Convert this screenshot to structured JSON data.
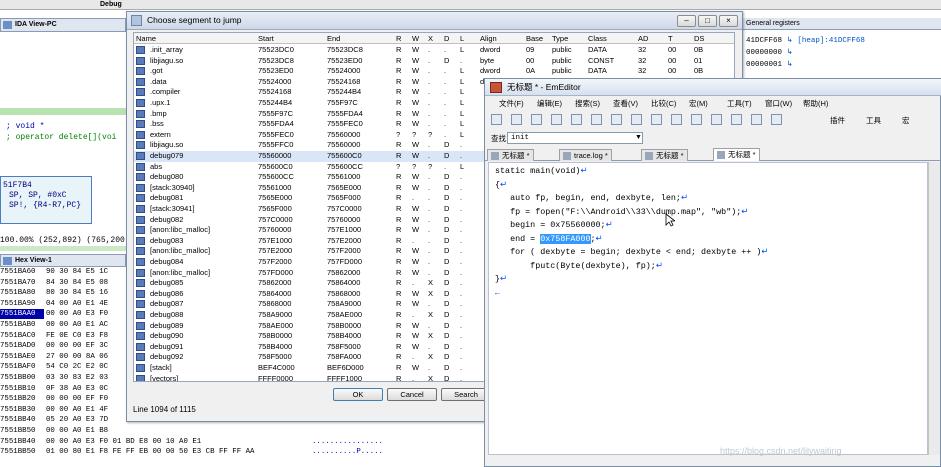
{
  "ida": {
    "debug_tab": "Debug",
    "view_title": "IDA View-PC",
    "code_lines": [
      "; void *",
      "; operator delete[](voi"
    ],
    "node_lines": [
      "51F7B4",
      "SP, SP, #0xC",
      "SP!, {R4-R7,PC}"
    ],
    "status": "100.00% (252,892) (765,200)",
    "hex_title": "Hex View-1",
    "hex_rows": [
      {
        "addr": "7551BA60",
        "bytes": "90 30 84 E5 1C",
        "ascii": ""
      },
      {
        "addr": "7551BA70",
        "bytes": "84 30 84 E5 08",
        "ascii": ""
      },
      {
        "addr": "7551BA80",
        "bytes": "80 30 84 E5 16",
        "ascii": ""
      },
      {
        "addr": "7551BA90",
        "bytes": "04 00 A0 E1 4E",
        "ascii": ""
      },
      {
        "addr": "7551BAA0",
        "bytes": "00 00 A0 E3 F0",
        "ascii": ""
      },
      {
        "addr": "7551BAB0",
        "bytes": "00 00 A0 E1 AC",
        "ascii": ""
      },
      {
        "addr": "7551BAC0",
        "bytes": "FE 0E C0 E3 F8",
        "ascii": ""
      },
      {
        "addr": "7551BAD0",
        "bytes": "00 00 00 EF 3C",
        "ascii": ""
      },
      {
        "addr": "7551BAE0",
        "bytes": "27 00 00 8A 06",
        "ascii": ""
      },
      {
        "addr": "7551BAF0",
        "bytes": "54 C0 2C E2 0C",
        "ascii": ""
      },
      {
        "addr": "7551BB00",
        "bytes": "03 30 83 E2 03",
        "ascii": ""
      },
      {
        "addr": "7551BB10",
        "bytes": "0F 38 A0 E3 0C",
        "ascii": ""
      },
      {
        "addr": "7551BB20",
        "bytes": "00 00 00 EF F0",
        "ascii": ""
      },
      {
        "addr": "7551BB30",
        "bytes": "00 00 A0 E1 4F",
        "ascii": ""
      },
      {
        "addr": "7551BB40",
        "bytes": "05 20 A0 E3 7D",
        "ascii": ""
      },
      {
        "addr": "7551BB50",
        "bytes": "00 00 A0 E1 B8",
        "ascii": ""
      },
      {
        "addr": "7551BB40",
        "bytes": "00 00 A0 E3 F0 01 BD E8 00 10 A0 E1",
        "ascii": "................"
      },
      {
        "addr": "7551BB50",
        "bytes": "01 00 80 E1 F8 FE FF EB 00 00 50 E3 CB FF FF AA",
        "ascii": "..........P....."
      }
    ],
    "highlight_row": 4
  },
  "registers": {
    "title": "General registers",
    "rows": [
      {
        "val": "41DCFF68",
        "cmt": "↳ [heap]:41DCFF68"
      },
      {
        "val": "00000000",
        "cmt": "↳"
      },
      {
        "val": "00000001",
        "cmt": "↳"
      }
    ]
  },
  "dialog": {
    "title": "Choose segment to jump",
    "headers": [
      "Name",
      "Start",
      "End",
      "R",
      "W",
      "X",
      "D",
      "L",
      "Align",
      "Base",
      "Type",
      "Class",
      "AD",
      "T",
      "DS"
    ],
    "rows": [
      [
        ".init_array",
        "75523DC0",
        "75523DC8",
        "R",
        "W",
        ".",
        ".",
        "L",
        "dword",
        "09",
        "public",
        "DATA",
        "32",
        "00",
        "0B"
      ],
      [
        "libjiagu.so",
        "75523DC8",
        "75523ED0",
        "R",
        "W",
        ".",
        "D",
        ".",
        "byte",
        "00",
        "public",
        "CONST",
        "32",
        "00",
        "01"
      ],
      [
        ".got",
        "75523ED0",
        "75524000",
        "R",
        "W",
        ".",
        ".",
        "L",
        "dword",
        "0A",
        "public",
        "DATA",
        "32",
        "00",
        "0B"
      ],
      [
        ".data",
        "75524000",
        "75524168",
        "R",
        "W",
        ".",
        ".",
        "L",
        "dword",
        "0B",
        "public",
        "DATA",
        "32",
        "00",
        "0B"
      ],
      [
        ".compiler",
        "75524168",
        "755244B4",
        "R",
        "W",
        ".",
        ".",
        "L",
        "",
        "",
        "",
        "",
        "",
        "",
        ""
      ],
      [
        ".upx.1",
        "755244B4",
        "755F97C",
        "R",
        "W",
        ".",
        ".",
        "L",
        "",
        "",
        "",
        "",
        "",
        "",
        ""
      ],
      [
        ".bmp",
        "7555F97C",
        "7555FDA4",
        "R",
        "W",
        ".",
        ".",
        "L",
        "",
        "",
        "",
        "",
        "",
        "",
        ""
      ],
      [
        ".bss",
        "7555FDA4",
        "7555FEC0",
        "R",
        "W",
        ".",
        ".",
        "L",
        "",
        "",
        "",
        "",
        "",
        "",
        ""
      ],
      [
        "extern",
        "7555FEC0",
        "75560000",
        "?",
        "?",
        "?",
        ".",
        "L",
        "",
        "",
        "",
        "",
        "",
        "",
        ""
      ],
      [
        "libjiagu.so",
        "7555FFC0",
        "75560000",
        "R",
        "W",
        ".",
        "D",
        ".",
        "",
        "",
        "",
        "",
        "",
        "",
        ""
      ],
      [
        "debug079",
        "75560000",
        "755600C0",
        "R",
        "W",
        ".",
        "D",
        ".",
        "",
        "",
        "",
        "",
        "",
        "",
        ""
      ],
      [
        "abs",
        "755600C0",
        "755600CC",
        "?",
        "?",
        "?",
        ".",
        "L",
        "",
        "",
        "",
        "",
        "",
        "",
        ""
      ],
      [
        "debug080",
        "755600CC",
        "75561000",
        "R",
        "W",
        ".",
        "D",
        ".",
        "",
        "",
        "",
        "",
        "",
        "",
        ""
      ],
      [
        "[stack:30940]",
        "75561000",
        "7565E000",
        "R",
        "W",
        ".",
        "D",
        ".",
        "",
        "",
        "",
        "",
        "",
        "",
        ""
      ],
      [
        "debug081",
        "7565E000",
        "7565F000",
        "R",
        ".",
        ".",
        "D",
        ".",
        "",
        "",
        "",
        "",
        "",
        "",
        ""
      ],
      [
        "[stack:30941]",
        "7565F000",
        "757C0000",
        "R",
        "W",
        ".",
        "D",
        ".",
        "",
        "",
        "",
        "",
        "",
        "",
        ""
      ],
      [
        "debug082",
        "757C0000",
        "75760000",
        "R",
        "W",
        ".",
        "D",
        ".",
        "",
        "",
        "",
        "",
        "",
        "",
        ""
      ],
      [
        "[anon:libc_malloc]",
        "75760000",
        "757E1000",
        "R",
        "W",
        ".",
        "D",
        ".",
        "",
        "",
        "",
        "",
        "",
        "",
        ""
      ],
      [
        "debug083",
        "757E1000",
        "757E2000",
        "R",
        ".",
        ".",
        "D",
        ".",
        "",
        "",
        "",
        "",
        "",
        "",
        ""
      ],
      [
        "[anon:libc_malloc]",
        "757E2000",
        "757F2000",
        "R",
        "W",
        ".",
        "D",
        ".",
        "",
        "",
        "",
        "",
        "",
        "",
        ""
      ],
      [
        "debug084",
        "757F2000",
        "757FD000",
        "R",
        "W",
        ".",
        "D",
        ".",
        "",
        "",
        "",
        "",
        "",
        "",
        ""
      ],
      [
        "[anon:libc_malloc]",
        "757FD000",
        "75862000",
        "R",
        "W",
        ".",
        "D",
        ".",
        "",
        "",
        "",
        "",
        "",
        "",
        ""
      ],
      [
        "debug085",
        "75862000",
        "75864000",
        "R",
        ".",
        "X",
        "D",
        ".",
        "",
        "",
        "",
        "",
        "",
        "",
        ""
      ],
      [
        "debug086",
        "75864000",
        "75868000",
        "R",
        "W",
        "X",
        "D",
        ".",
        "",
        "",
        "",
        "",
        "",
        "",
        ""
      ],
      [
        "debug087",
        "75868000",
        "758A9000",
        "R",
        "W",
        ".",
        "D",
        ".",
        "",
        "",
        "",
        "",
        "",
        "",
        ""
      ],
      [
        "debug088",
        "758A9000",
        "758AE000",
        "R",
        ".",
        "X",
        "D",
        ".",
        "",
        "",
        "",
        "",
        "",
        "",
        ""
      ],
      [
        "debug089",
        "758AE000",
        "758B0000",
        "R",
        "W",
        ".",
        "D",
        ".",
        "",
        "",
        "",
        "",
        "",
        "",
        ""
      ],
      [
        "debug090",
        "758B0000",
        "758B4000",
        "R",
        "W",
        "X",
        "D",
        ".",
        "",
        "",
        "",
        "",
        "",
        "",
        ""
      ],
      [
        "debug091",
        "758B4000",
        "758F5000",
        "R",
        "W",
        ".",
        "D",
        ".",
        "",
        "",
        "",
        "",
        "",
        "",
        ""
      ],
      [
        "debug092",
        "758F5000",
        "758FA000",
        "R",
        ".",
        "X",
        "D",
        ".",
        "",
        "",
        "",
        "",
        "",
        "",
        ""
      ],
      [
        "[stack]",
        "BEF4C000",
        "BEF6D000",
        "R",
        "W",
        ".",
        "D",
        ".",
        "",
        "",
        "",
        "",
        "",
        "",
        ""
      ],
      [
        "[vectors]",
        "FFFF0000",
        "FFFF1000",
        "R",
        ".",
        "X",
        "D",
        ".",
        "",
        "",
        "",
        "",
        "",
        "",
        ""
      ]
    ],
    "selected_row": 10,
    "footer": "Line 1094 of 1115",
    "buttons": {
      "ok": "OK",
      "cancel": "Cancel",
      "search": "Search"
    }
  },
  "emeditor": {
    "title": "无标题 * - EmEditor",
    "menu": [
      "文件(F)",
      "编辑(E)",
      "搜索(S)",
      "查看(V)",
      "比较(C)",
      "宏(M)",
      "工具(T)",
      "窗口(W)",
      "帮助(H)"
    ],
    "toolbar_right": [
      "插件",
      "工具",
      "宏"
    ],
    "find_label": "查找",
    "find_value": "init",
    "tabs": [
      "无标题 *",
      "trace.log *",
      "无标题 *",
      "无标题 *"
    ],
    "active_tab": 3,
    "lines": [
      {
        "text": "static main(void)",
        "ret": "↵"
      },
      {
        "text": "{",
        "ret": "↵"
      },
      {
        "text": "   auto fp, begin, end, dexbyte, len;",
        "ret": "↵"
      },
      {
        "text": "   fp = fopen(\"F:\\\\Android\\\\33\\\\dump.map\", \"wb\");",
        "ret": "↵"
      },
      {
        "text": "   begin = 0x75560000;",
        "ret": "↵"
      },
      {
        "text": "   end = ",
        "sel": "0x758FA000",
        "after": ";",
        "ret": "↵"
      },
      {
        "text": "   for ( dexbyte = begin; dexbyte < end; dexbyte ++ )",
        "ret": "↵"
      },
      {
        "text": "       fputc(Byte(dexbyte), fp);",
        "ret": "↵"
      },
      {
        "text": "}",
        "ret": "↵"
      },
      {
        "text": "",
        "ret": "←"
      }
    ]
  },
  "watermark": "https://blog.csdn.net/lilywaiting"
}
